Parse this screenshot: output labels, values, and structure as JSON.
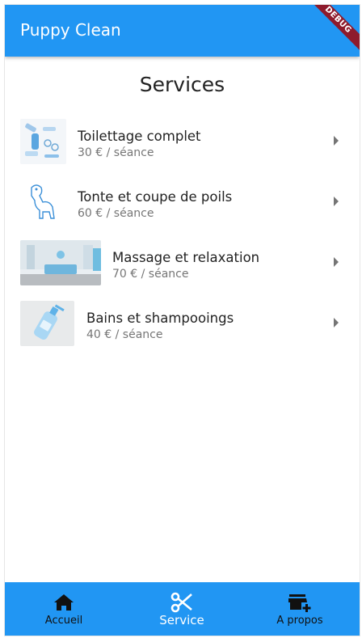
{
  "app": {
    "title": "Puppy Clean",
    "debug_label": "DEBUG",
    "accent": "#2196f3"
  },
  "page": {
    "title": "Services"
  },
  "services": [
    {
      "title": "Toilettage complet",
      "price": "30 € / séance",
      "image": "grooming-tools-image"
    },
    {
      "title": "Tonte et coupe de poils",
      "price": "60 € / séance",
      "image": "dog-sketch-image"
    },
    {
      "title": "Massage et relaxation",
      "price": "70 € / séance",
      "image": "salon-reception-image"
    },
    {
      "title": "Bains et shampooings",
      "price": "40 € / séance",
      "image": "shampoo-bottle-image"
    }
  ],
  "nav": {
    "items": [
      {
        "label": "Accueil",
        "icon": "home-icon"
      },
      {
        "label": "Service",
        "icon": "scissors-icon"
      },
      {
        "label": "A propos",
        "icon": "store-add-icon"
      }
    ],
    "active": "Service"
  }
}
